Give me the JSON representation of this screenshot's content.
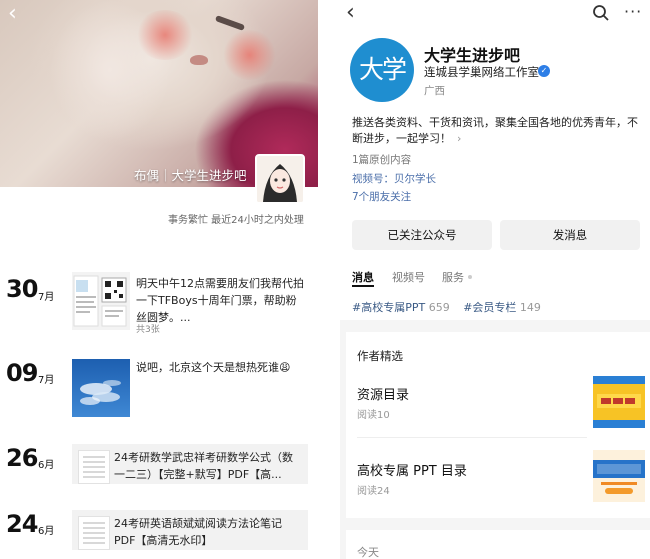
{
  "left": {
    "cover_caption": "布偶｜大学生进步吧",
    "status": "事务繁忙  最近24小时之内处理",
    "posts": [
      {
        "day": "30",
        "month": "7月",
        "text": "明天中午12点需要朋友们我帮代拍一下TFBoys十周年门票，帮助粉丝圆梦。...",
        "sub": "共3张"
      },
      {
        "day": "09",
        "month": "7月",
        "text": "说吧，北京这个天是想热死谁😩"
      },
      {
        "day": "26",
        "month": "6月",
        "text": "24考研数学武忠祥考研数学公式（数一二三）【完整+默写】PDF【高..."
      },
      {
        "day": "24",
        "month": "6月",
        "text": "24考研英语颉斌斌阅读方法论笔记PDF【高清无水印】"
      }
    ]
  },
  "right": {
    "nav": {
      "back_icon": "back-chevron-icon",
      "search_icon": "search-icon",
      "more_icon": "more-dots-icon"
    },
    "avatar_text": "大学",
    "name": "大学生进步吧",
    "org": "连城县学巢网络工作室",
    "region": "广西",
    "description": "推送各类资料、干货和资讯，聚集全国各地的优秀青年，不断进步，一起学习！",
    "original_count": "1篇原创内容",
    "video_id": "视频号：贝尔学长",
    "friends": "7个朋友关注",
    "follow_button": "已关注公众号",
    "message_button": "发消息",
    "tabs": [
      "消息",
      "视频号",
      "服务"
    ],
    "tags": [
      {
        "name": "#高校专属PPT",
        "count": "659"
      },
      {
        "name": "#会员专栏",
        "count": "149"
      }
    ],
    "featured_title": "作者精选",
    "featured": [
      {
        "title": "资源目录",
        "read": "阅读10"
      },
      {
        "title": "高校专属 PPT 目录",
        "read": "阅读24"
      }
    ],
    "today": "今天",
    "colors": {
      "brand_blue": "#1f8ed0",
      "link": "#4a6ea9",
      "verify": "#2d7ee6"
    }
  }
}
